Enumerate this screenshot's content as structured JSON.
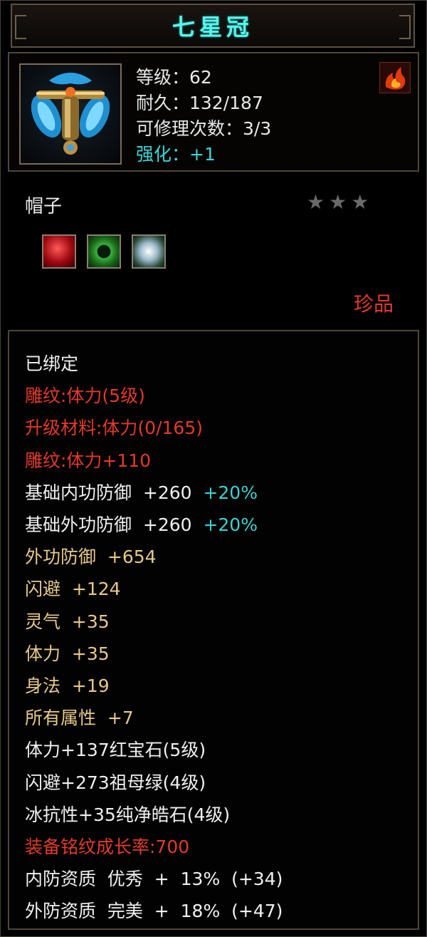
{
  "title": "七星冠",
  "stats": {
    "level": "等级：62",
    "durability": "耐久：132/187",
    "repairs": "可修理次数：3/3",
    "enhance": "强化：+1"
  },
  "item_type": "帽子",
  "stars": "★★★",
  "rarity": "珍品",
  "gems": [
    {
      "icon": "ruby-gem-icon",
      "color": "#c0141a"
    },
    {
      "icon": "emerald-gem-icon",
      "color": "#2a9a30"
    },
    {
      "icon": "diamond-gem-icon",
      "color": "#a8c8d0"
    }
  ],
  "attributes": [
    {
      "text": "已绑定",
      "tone": "white"
    },
    {
      "text": "雕纹:体力(5级)",
      "tone": "red"
    },
    {
      "text": "升级材料:体力(0/165)",
      "tone": "red"
    },
    {
      "text": "雕纹:体力+110",
      "tone": "red"
    },
    {
      "text": "基础内功防御  +260",
      "tone": "white",
      "bonus": "+20%"
    },
    {
      "text": "基础外功防御  +260",
      "tone": "white",
      "bonus": "+20%"
    },
    {
      "text": "外功防御  +654",
      "tone": "gold"
    },
    {
      "text": "闪避  +124",
      "tone": "gold"
    },
    {
      "text": "灵气  +35",
      "tone": "gold"
    },
    {
      "text": "体力  +35",
      "tone": "gold"
    },
    {
      "text": "身法  +19",
      "tone": "gold"
    },
    {
      "text": "所有属性  +7",
      "tone": "gold"
    },
    {
      "text": "体力+137红宝石(5级)",
      "tone": "white"
    },
    {
      "text": "闪避+273祖母绿(4级)",
      "tone": "white"
    },
    {
      "text": "冰抗性+35纯净皓石(4级)",
      "tone": "white"
    },
    {
      "text": "装备铭纹成长率:700",
      "tone": "red"
    },
    {
      "text": "内防资质  优秀  +  13%  (+34)",
      "tone": "white"
    },
    {
      "text": "外防资质  完美  +  18%  (+47)",
      "tone": "white"
    }
  ]
}
